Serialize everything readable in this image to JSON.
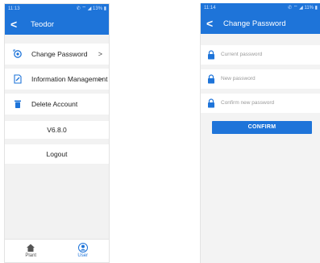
{
  "left_screen": {
    "status": {
      "time": "11:13",
      "icons": "✆ ⌔ ◢ 13% ▮"
    },
    "header": {
      "back": "<",
      "title": "Teodor"
    },
    "menu": [
      {
        "label": "Change Password",
        "icon": "password-key-icon",
        "chevron": ">"
      },
      {
        "label": "Information Management",
        "icon": "edit-document-icon",
        "chevron": ">"
      },
      {
        "label": "Delete Account",
        "icon": "trash-icon",
        "chevron": ""
      }
    ],
    "version": "V6.8.0",
    "logout": "Logout",
    "tabs": [
      {
        "label": "Plant",
        "icon": "home-icon",
        "active": false
      },
      {
        "label": "User",
        "icon": "user-icon",
        "active": true
      }
    ]
  },
  "right_screen": {
    "status": {
      "time": "11:14",
      "icons": "✆ ⌔ ◢ 11% ▮"
    },
    "header": {
      "back": "<",
      "title": "Change Password"
    },
    "fields": [
      {
        "placeholder": "Current password"
      },
      {
        "placeholder": "New password"
      },
      {
        "placeholder": "Confirm new password"
      }
    ],
    "confirm_label": "CONFIRM"
  },
  "colors": {
    "accent": "#1e74d9",
    "text": "#222222",
    "placeholder": "#9a9a9a",
    "background": "#f2f2f2",
    "tab_inactive": "#555555"
  }
}
